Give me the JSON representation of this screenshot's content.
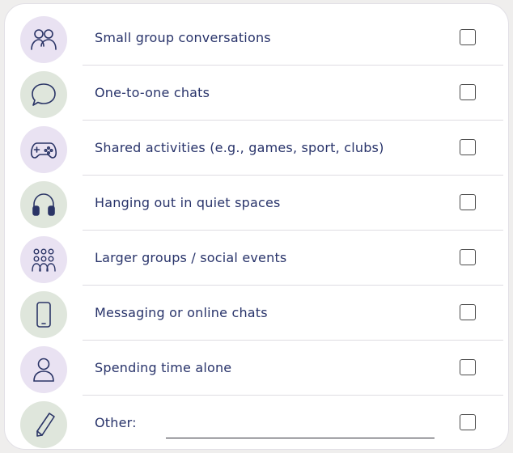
{
  "colors": {
    "text": "#28336a",
    "icon_stroke": "#2a3466",
    "purple_circle": "#e9e2f2",
    "green_circle": "#dfe6dc",
    "checkbox_border": "#4a4a4a"
  },
  "options": [
    {
      "label": "Small group conversations",
      "icon": "two-people-icon",
      "circle": "purple"
    },
    {
      "label": "One-to-one chats",
      "icon": "speech-bubble-icon",
      "circle": "green"
    },
    {
      "label": "Shared activities (e.g., games, sport, clubs)",
      "icon": "game-controller-icon",
      "circle": "purple"
    },
    {
      "label": "Hanging out in quiet spaces",
      "icon": "headphones-icon",
      "circle": "green"
    },
    {
      "label": "Larger groups / social events",
      "icon": "crowd-icon",
      "circle": "purple"
    },
    {
      "label": "Messaging or online chats",
      "icon": "smartphone-icon",
      "circle": "green"
    },
    {
      "label": "Spending time alone",
      "icon": "single-person-icon",
      "circle": "purple"
    },
    {
      "label": "Other:",
      "icon": "pencil-icon",
      "circle": "green"
    }
  ]
}
